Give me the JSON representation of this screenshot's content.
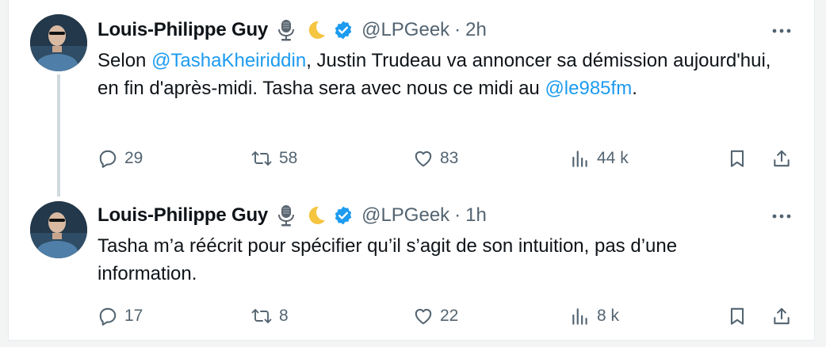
{
  "tweets": [
    {
      "author": {
        "name": "Louis-Philippe Guy",
        "handle": "@LPGeek",
        "emojis": [
          "microphone-icon",
          "crescent-moon-icon"
        ],
        "verified": true
      },
      "time": "2h",
      "text": {
        "p1": "Selon ",
        "mention1": "@TashaKheiriddin",
        "p2": ", Justin Trudeau va annoncer sa démission aujourd'hui, en fin d'après-midi. Tasha sera avec nous ce midi au ",
        "mention2": "@le985fm",
        "p3": "."
      },
      "stats": {
        "replies": "29",
        "reposts": "58",
        "likes": "83",
        "views": "44 k"
      }
    },
    {
      "author": {
        "name": "Louis-Philippe Guy",
        "handle": "@LPGeek",
        "emojis": [
          "microphone-icon",
          "crescent-moon-icon"
        ],
        "verified": true
      },
      "time": "1h",
      "text": {
        "p1": "Tasha m’a réécrit pour spécifier qu’il s’agit de son intuition, pas d’une information."
      },
      "stats": {
        "replies": "17",
        "reposts": "8",
        "likes": "22",
        "views": "8 k"
      }
    }
  ],
  "colors": {
    "link": "#1d9bf0",
    "muted": "#536471",
    "text": "#0f1419",
    "verified": "#1d9bf0",
    "thread_line": "#cfd9de"
  }
}
